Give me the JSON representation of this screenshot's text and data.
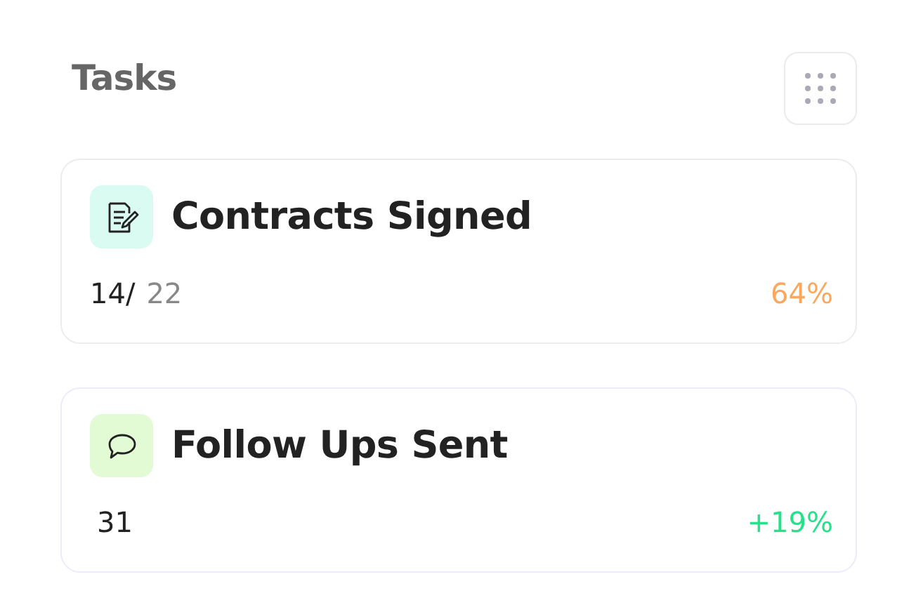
{
  "header": {
    "title": "Tasks"
  },
  "cards": [
    {
      "kind": "ratio",
      "color": "#d9fbf1",
      "title": "Contracts Signed",
      "value": "14/",
      "total": "22",
      "change": "64%"
    },
    {
      "kind": "growth",
      "color": "#e2fbd4",
      "title": "Follow Ups Sent",
      "value": "31",
      "change": "+19%"
    }
  ]
}
